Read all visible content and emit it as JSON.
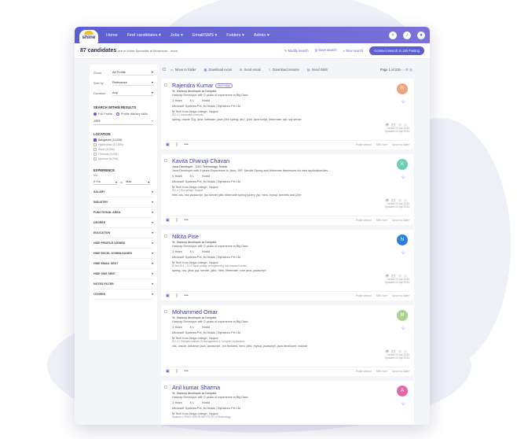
{
  "nav": {
    "logo": "shine",
    "items": [
      "Home",
      "Find candidates ▾",
      "Jobs ▾",
      "Email/SMS ▾",
      "Folders ▾",
      "Admin ▾"
    ]
  },
  "toolbar": {
    "count": "87 candidates",
    "context": "are in folder Specialist at Morpheus…more",
    "links": [
      "✎ Modify search",
      "🖫 Save search",
      "⌕ New search"
    ],
    "post_button": "Connect Search to Job Posting"
  },
  "sidebar": {
    "show_label": "Show",
    "show_value": "All Profile",
    "sort_label": "Sort by",
    "sort_value": "Relevance",
    "duration_label": "Duration",
    "duration_value": "Any",
    "search_within": "SEARCH WITHIN RESULTS",
    "radio_full": "Full Profile",
    "radio_title": "Profile title/key skills",
    "search_value": "J2EE",
    "location_title": "LOCATION",
    "locations": [
      "Bangalore (11,028)",
      "Hyderabad (10,659)",
      "Pune (6,094)",
      "Chennai (8,081)",
      "Mumbai (6,299)"
    ],
    "experience_title": "EXPERIENCE",
    "exp_min_label": "Min",
    "exp_min": "2 Yrs",
    "exp_to": "to",
    "exp_max": "Max",
    "filters": [
      "SALARY",
      "INDUSTRY",
      "FUNCTIONAL AREA",
      "DEGREE",
      "EDUCATION",
      "HIDE PROFILE VIEWED",
      "HIDE EXCEL DOWNLOADED",
      "HIDE EMAIL SENT",
      "HIDE SMS SENT",
      "NOTES FILTER",
      "OTHERS"
    ]
  },
  "actions": {
    "items": [
      "Move to folder",
      "Download excel",
      "Send email",
      "Download resume",
      "Send SMS"
    ],
    "pager": "Page 1 of 215"
  },
  "card_meta": {
    "viewed": "Profile viewed",
    "sms": "SMS Sent",
    "moved": "Moved to folder",
    "active": "Active 04 Apr 2019",
    "updated": "Updated 04 Apr 2019",
    "featured": "FEATURED"
  },
  "candidates": [
    {
      "name": "Rajendra Kumar",
      "initial": "R",
      "color": "#f0a37c",
      "title": "Sr. Hadoop developer at Genpact",
      "desc": "Hadoop Developer with 2 years of experience in Big Data",
      "exp": "4 Years",
      "sal": "8 L",
      "loc": "Noida",
      "company": "Microsoft Systems Pvt. ltd Noida | Dynazoro Pvt Ltd",
      "edu": "M.Tech from Kings college, Tanjore",
      "edu_sub": "B.C.A | Annamalai university",
      "skills": "spring, oracle 11g, java, software, java j2ee spring, db2, j2ee, java script, hibernate, ejb, sql server"
    },
    {
      "name": "Kavita Dhanaji Chavan",
      "initial": "K",
      "color": "#6ecfb8",
      "title": "Java Developer - DXC Technology, Noida",
      "desc": "Java Developer with 5 years Experience in Java, JSP, Servlet,Spring and hibernate framework for web application/dev…",
      "exp": "4 Years",
      "sal": "8 L",
      "loc": "Noida",
      "company": "Microsoft Systems Pvt. ltd Noida | Dynazoro Pvt Ltd",
      "edu": "M.Tech from Kings college, Tanjore",
      "edu_sub": "B.C.A | Ecs college, Gujarat",
      "skills": "html css, css javascript, jsp servlet jdbc hibernate spring jquery, jsp, html, mysql, servlets and j2ee"
    },
    {
      "name": "Nikita Pise",
      "initial": "N",
      "color": "#2f7fe0",
      "title": "Sr. Hadoop developer at Genpact",
      "desc": "Hadoop Developer with 2 years of experience in Big Data",
      "exp": "4 Years",
      "sal": "8 L",
      "loc": "Noida",
      "company": "Microsoft Systems Pvt. ltd Noida | Dynazoro Pvt Ltd",
      "edu": "M.Tech from Kings college, Tanjore",
      "edu_sub": "B.Tech/B.E. | R.H Sapat college of engineering and research center",
      "skills": "spring, css, java, jsp, servlet, jdbc, html, hibernate, core java, javascript"
    },
    {
      "name": "Mohammed Omar",
      "initial": "M",
      "color": "#a8d18e",
      "title": "Sr. Hadoop developer at Genpact",
      "desc": "Hadoop Developer with 2 years of experience in Big Data",
      "exp": "4 Years",
      "sal": "8 L",
      "loc": "Noida",
      "company": "Microsoft Systems Pvt. ltd Noida | Dynazoro Pvt Ltd",
      "edu": "M.Tech from Kings college, Tanjore",
      "edu_sub": "B.C.A | Sinhgad Institute Of Management & Computer Application",
      "skills": "css, oracle, advance java, javascript, ,ext finished, html, jdbc, mysql, javascript, java developer, eclipse"
    },
    {
      "name": "Anil kumar Sharma",
      "initial": "A",
      "color": "#e06aa8",
      "title": "Sr. Hadoop developer at Genpact",
      "desc": "Hadoop Developer with 2 years of experience in Big Data",
      "exp": "4 Years",
      "sal": "8 L",
      "loc": "Noida",
      "company": "Microsoft Systems Pvt. ltd Noida | Dynazoro Pvt Ltd",
      "edu": "M.Tech from Kings college, Tanjore",
      "edu_sub": "Diploma | ITRA'S VISION INSTITUTE Of Technology",
      "skills": ""
    }
  ]
}
